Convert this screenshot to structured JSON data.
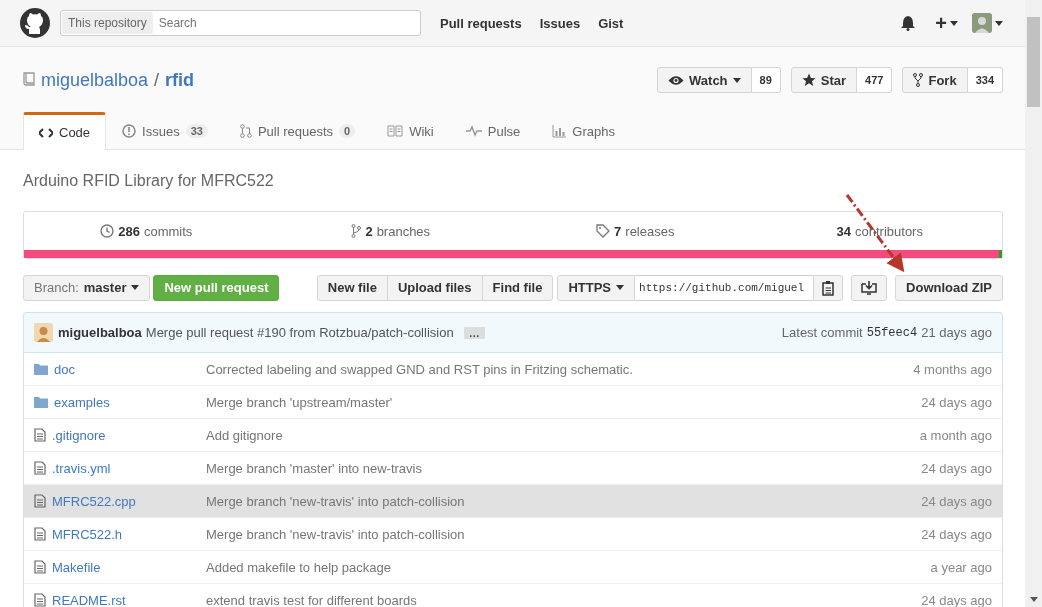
{
  "header": {
    "scope": "This repository",
    "search": {
      "placeholder": "Search"
    },
    "nav": [
      "Pull requests",
      "Issues",
      "Gist"
    ],
    "plus": "+"
  },
  "repo": {
    "owner": "miguelbalboa",
    "separator": "/",
    "name": "rfid"
  },
  "actions": [
    {
      "label": "Watch",
      "kind": "watch",
      "count": "89"
    },
    {
      "label": "Star",
      "kind": "star",
      "count": "477"
    },
    {
      "label": "Fork",
      "kind": "fork",
      "count": "334"
    }
  ],
  "tabs": [
    {
      "label": "Code",
      "kind": "code",
      "selected": true
    },
    {
      "label": "Issues",
      "kind": "issues",
      "count": "33",
      "selected": false
    },
    {
      "label": "Pull requests",
      "kind": "pulls",
      "count": "0",
      "selected": false
    },
    {
      "label": "Wiki",
      "kind": "wiki",
      "selected": false
    },
    {
      "label": "Pulse",
      "kind": "pulse",
      "selected": false
    },
    {
      "label": "Graphs",
      "kind": "graphs",
      "selected": false
    }
  ],
  "description": "Arduino RFID Library for MFRC522",
  "summary": [
    {
      "kind": "commits",
      "number": "286",
      "label": "commits"
    },
    {
      "kind": "branches",
      "number": "2",
      "label": "branches"
    },
    {
      "kind": "releases",
      "number": "7",
      "label": "releases"
    },
    {
      "kind": "contributors",
      "number": "34",
      "label": "contributors"
    }
  ],
  "branch": {
    "prefix": "Branch:",
    "name": "master"
  },
  "new_pull_request": "New pull request",
  "file_buttons": [
    "New file",
    "Upload files",
    "Find file"
  ],
  "clone": {
    "protocol": "HTTPS",
    "url": "https://github.com/miguel"
  },
  "download": "Download ZIP",
  "commit": {
    "author": "miguelbalboa",
    "message": "Merge pull request #190 from Rotzbua/patch-collision",
    "ellipsis": "…",
    "prefix": "Latest commit",
    "sha": "55feec4",
    "age": "21 days ago"
  },
  "files": [
    {
      "kind": "dir",
      "name": "doc",
      "message": "Corrected labeling and swapped GND and RST pins in Fritzing schematic.",
      "age": "4 months ago",
      "hovered": false
    },
    {
      "kind": "dir",
      "name": "examples",
      "message": "Merge branch 'upstream/master'",
      "age": "24 days ago",
      "hovered": false
    },
    {
      "kind": "file",
      "name": ".gitignore",
      "message": "Add gitignore",
      "age": "a month ago",
      "hovered": false
    },
    {
      "kind": "file",
      "name": ".travis.yml",
      "message": "Merge branch 'master' into new-travis",
      "age": "24 days ago",
      "hovered": false
    },
    {
      "kind": "file",
      "name": "MFRC522.cpp",
      "message": "Merge branch 'new-travis' into patch-collision",
      "age": "24 days ago",
      "hovered": true
    },
    {
      "kind": "file",
      "name": "MFRC522.h",
      "message": "Merge branch 'new-travis' into patch-collision",
      "age": "24 days ago",
      "hovered": false
    },
    {
      "kind": "file",
      "name": "Makefile",
      "message": "Added makefile to help package",
      "age": "a year ago",
      "hovered": false
    },
    {
      "kind": "file",
      "name": "README.rst",
      "message": "extend travis test for different boards",
      "age": "24 days ago",
      "hovered": false
    }
  ]
}
